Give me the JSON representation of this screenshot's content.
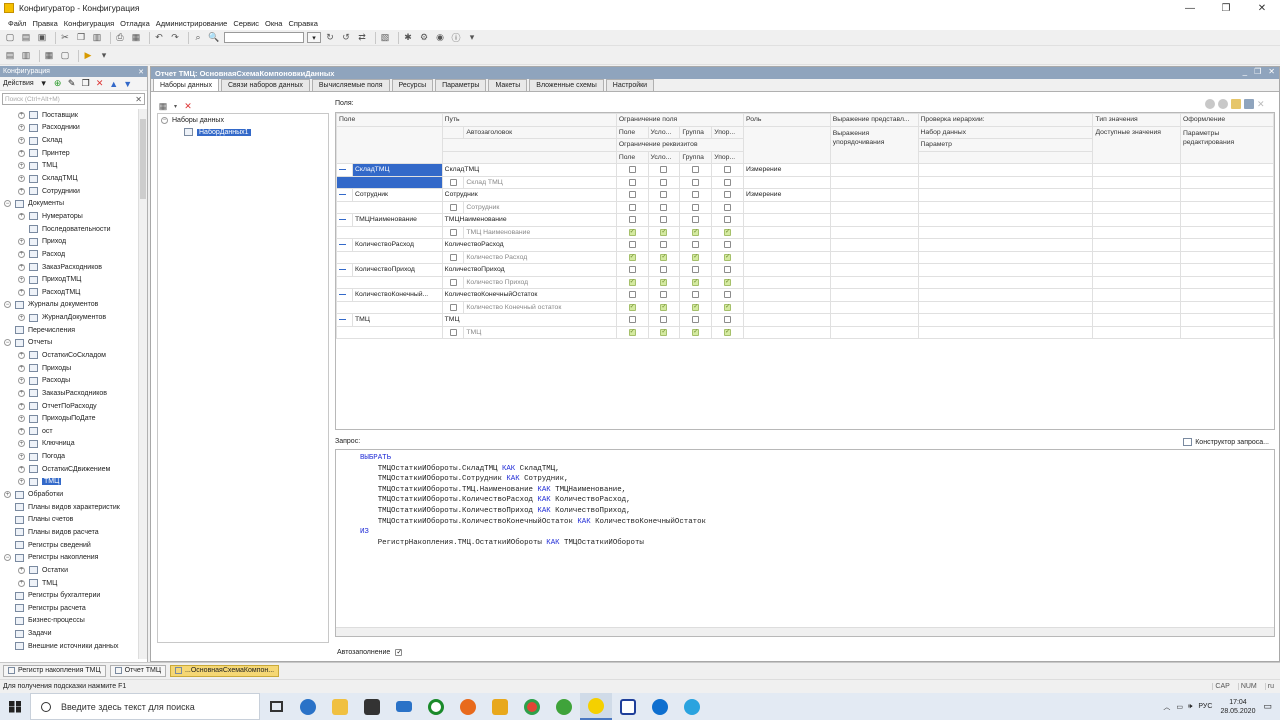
{
  "window": {
    "title": "Конфигуратор - Конфигурация"
  },
  "menu": [
    "Файл",
    "Правка",
    "Конфигурация",
    "Отладка",
    "Администрирование",
    "Сервис",
    "Окна",
    "Справка"
  ],
  "left_panel": {
    "title": "Конфигурация",
    "actions_label": "Действия",
    "search_placeholder": "Поиск (Ctrl+Alt+M)",
    "tree": [
      {
        "label": "Поставщик",
        "level": 1,
        "exp": "+"
      },
      {
        "label": "Расходники",
        "level": 1,
        "exp": "+"
      },
      {
        "label": "Склад",
        "level": 1,
        "exp": "+"
      },
      {
        "label": "Принтер",
        "level": 1,
        "exp": "+"
      },
      {
        "label": "ТМЦ",
        "level": 1,
        "exp": "+"
      },
      {
        "label": "СкладТМЦ",
        "level": 1,
        "exp": "+"
      },
      {
        "label": "Сотрудники",
        "level": 1,
        "exp": "+"
      },
      {
        "label": "Документы",
        "level": 0,
        "exp": "−"
      },
      {
        "label": "Нумераторы",
        "level": 1,
        "exp": "+"
      },
      {
        "label": "Последовательности",
        "level": 1,
        "exp": ""
      },
      {
        "label": "Приход",
        "level": 1,
        "exp": "+"
      },
      {
        "label": "Расход",
        "level": 1,
        "exp": "+"
      },
      {
        "label": "ЗаказРасходников",
        "level": 1,
        "exp": "+"
      },
      {
        "label": "ПриходТМЦ",
        "level": 1,
        "exp": "+"
      },
      {
        "label": "РасходТМЦ",
        "level": 1,
        "exp": "+"
      },
      {
        "label": "Журналы документов",
        "level": 0,
        "exp": "−"
      },
      {
        "label": "ЖурналДокументов",
        "level": 1,
        "exp": "+"
      },
      {
        "label": "Перечисления",
        "level": 0,
        "exp": ""
      },
      {
        "label": "Отчеты",
        "level": 0,
        "exp": "−"
      },
      {
        "label": "ОстаткиСоСкладом",
        "level": 1,
        "exp": "+"
      },
      {
        "label": "Приходы",
        "level": 1,
        "exp": "+"
      },
      {
        "label": "Расходы",
        "level": 1,
        "exp": "+"
      },
      {
        "label": "ЗаказыРасходников",
        "level": 1,
        "exp": "+"
      },
      {
        "label": "ОтчетПоРасходу",
        "level": 1,
        "exp": "+"
      },
      {
        "label": "ПриходыПоДате",
        "level": 1,
        "exp": "+"
      },
      {
        "label": "ост",
        "level": 1,
        "exp": "+"
      },
      {
        "label": "Ключница",
        "level": 1,
        "exp": "+"
      },
      {
        "label": "Погода",
        "level": 1,
        "exp": "+"
      },
      {
        "label": "ОстаткиСДвижением",
        "level": 1,
        "exp": "+"
      },
      {
        "label": "ТМЦ",
        "level": 1,
        "exp": "+",
        "selected": true
      },
      {
        "label": "Обработки",
        "level": 0,
        "exp": "+"
      },
      {
        "label": "Планы видов характеристик",
        "level": 0,
        "exp": ""
      },
      {
        "label": "Планы счетов",
        "level": 0,
        "exp": ""
      },
      {
        "label": "Планы видов расчета",
        "level": 0,
        "exp": ""
      },
      {
        "label": "Регистры сведений",
        "level": 0,
        "exp": ""
      },
      {
        "label": "Регистры накопления",
        "level": 0,
        "exp": "−"
      },
      {
        "label": "Остатки",
        "level": 1,
        "exp": "+"
      },
      {
        "label": "ТМЦ",
        "level": 1,
        "exp": "+"
      },
      {
        "label": "Регистры бухгалтерии",
        "level": 0,
        "exp": ""
      },
      {
        "label": "Регистры расчета",
        "level": 0,
        "exp": ""
      },
      {
        "label": "Бизнес-процессы",
        "level": 0,
        "exp": ""
      },
      {
        "label": "Задачи",
        "level": 0,
        "exp": ""
      },
      {
        "label": "Внешние источники данных",
        "level": 0,
        "exp": ""
      }
    ]
  },
  "doc": {
    "title": "Отчет ТМЦ: ОсновнаяСхемаКомпоновкиДанных",
    "tabs": [
      "Наборы данных",
      "Связи наборов данных",
      "Вычисляемые поля",
      "Ресурсы",
      "Параметры",
      "Макеты",
      "Вложенные схемы",
      "Настройки"
    ],
    "datasets": {
      "root": "Наборы данных",
      "items": [
        "НаборДанных1"
      ]
    },
    "fields_label": "Поля:",
    "columns": {
      "field": "Поле",
      "path": "Путь",
      "title": "Автозаголовок",
      "restrict_field": "Ограничение поля",
      "restrict_attrs": "Ограничение реквизитов",
      "sub": [
        "Поле",
        "Усло...",
        "Группа",
        "Упор..."
      ],
      "role": "Роль",
      "expr_repr": "Выражение представл...",
      "expr_order": "Выражения упорядочивания",
      "hier": "Проверка иерархии:",
      "dataset": "Набор данных",
      "param": "Параметр",
      "value_type": "Тип значения",
      "avail_values": "Доступные значения",
      "format": "Оформление",
      "edit_params": "Параметры редактирования"
    },
    "rows": [
      {
        "field": "СкладТМЦ",
        "path": "СкладТМЦ",
        "title": "Склад ТМЦ",
        "role": "Измерение",
        "attr_on": false
      },
      {
        "field": "Сотрудник",
        "path": "Сотрудник",
        "title": "Сотрудник",
        "role": "Измерение",
        "attr_on": false
      },
      {
        "field": "ТМЦНаименование",
        "path": "ТМЦНаименование",
        "title": "ТМЦ Наименование",
        "role": "",
        "attr_on": true
      },
      {
        "field": "КоличествоРасход",
        "path": "КоличествоРасход",
        "title": "Количество Расход",
        "role": "",
        "attr_on": true
      },
      {
        "field": "КоличествоПриход",
        "path": "КоличествоПриход",
        "title": "Количество Приход",
        "role": "",
        "attr_on": true
      },
      {
        "field": "КоличествоКонечный...",
        "path": "КоличествоКонечныйОстаток",
        "title": "Количество Конечный остаток",
        "role": "",
        "attr_on": true
      },
      {
        "field": "ТМЦ",
        "path": "ТМЦ",
        "title": "ТМЦ",
        "role": "",
        "attr_on": true
      }
    ],
    "query_label": "Запрос:",
    "query_builder": "Конструктор запроса...",
    "query_lines": [
      [
        {
          "k": true,
          "t": "ВЫБРАТЬ"
        }
      ],
      [
        {
          "t": "    ТМЦОстаткиИОбороты.СкладТМЦ "
        },
        {
          "k": true,
          "t": "КАК"
        },
        {
          "t": " СкладТМЦ,"
        }
      ],
      [
        {
          "t": "    ТМЦОстаткиИОбороты.Сотрудник "
        },
        {
          "k": true,
          "t": "КАК"
        },
        {
          "t": " Сотрудник,"
        }
      ],
      [
        {
          "t": "    ТМЦОстаткиИОбороты.ТМЦ.Наименование "
        },
        {
          "k": true,
          "t": "КАК"
        },
        {
          "t": " ТМЦНаименование,"
        }
      ],
      [
        {
          "t": "    ТМЦОстаткиИОбороты.КоличествоРасход "
        },
        {
          "k": true,
          "t": "КАК"
        },
        {
          "t": " КоличествоРасход,"
        }
      ],
      [
        {
          "t": "    ТМЦОстаткиИОбороты.КоличествоПриход "
        },
        {
          "k": true,
          "t": "КАК"
        },
        {
          "t": " КоличествоПриход,"
        }
      ],
      [
        {
          "t": "    ТМЦОстаткиИОбороты.КоличествоКонечныйОстаток "
        },
        {
          "k": true,
          "t": "КАК"
        },
        {
          "t": " КоличествоКонечныйОстаток"
        }
      ],
      [
        {
          "k": true,
          "t": "ИЗ"
        }
      ],
      [
        {
          "t": "    РегистрНакопления.ТМЦ.ОстаткиИОбороты "
        },
        {
          "k": true,
          "t": "КАК"
        },
        {
          "t": " ТМЦОстаткиИОбороты"
        }
      ]
    ],
    "autofill_label": "Автозаполнение"
  },
  "window_tabs": [
    {
      "label": "Регистр накопления ТМЦ",
      "active": false
    },
    {
      "label": "Отчет ТМЦ",
      "active": false
    },
    {
      "label": "...ОсновнаяСхемаКомпон...",
      "active": true
    }
  ],
  "status": {
    "hint": "Для получения подсказки нажмите F1",
    "caps": "CAP",
    "num": "NUM",
    "lang": "ru"
  },
  "taskbar": {
    "search_placeholder": "Введите здесь текст для поиска",
    "lang": "РУС",
    "time": "17:04",
    "date": "28.05.2020"
  }
}
